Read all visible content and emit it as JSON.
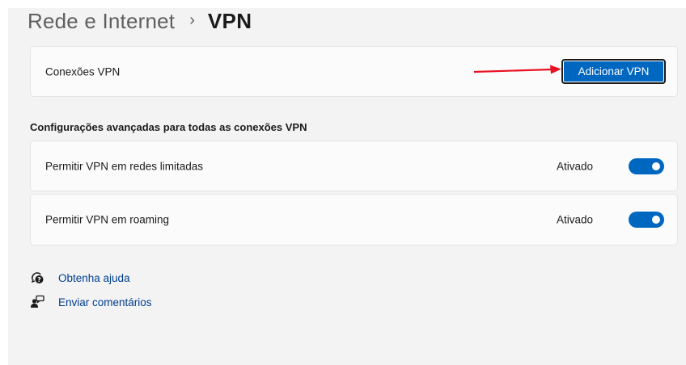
{
  "header": {
    "parent": "Rede e Internet",
    "separator": "›",
    "current": "VPN"
  },
  "vpn_connections": {
    "label": "Conexões VPN",
    "button_label": "Adicionar VPN",
    "annotation_arrow_color": "#e81123"
  },
  "advanced": {
    "title": "Configurações avançadas para todas as conexões VPN",
    "settings": [
      {
        "label": "Permitir VPN em redes limitadas",
        "state": "Ativado",
        "on": true
      },
      {
        "label": "Permitir VPN em roaming",
        "state": "Ativado",
        "on": true
      }
    ]
  },
  "links": [
    {
      "label": "Obtenha ajuda",
      "icon": "help-icon"
    },
    {
      "label": "Enviar comentários",
      "icon": "feedback-icon"
    }
  ],
  "colors": {
    "accent": "#0067c0",
    "link": "#003e92",
    "background": "#f3f3f3",
    "card": "#fbfbfb"
  }
}
